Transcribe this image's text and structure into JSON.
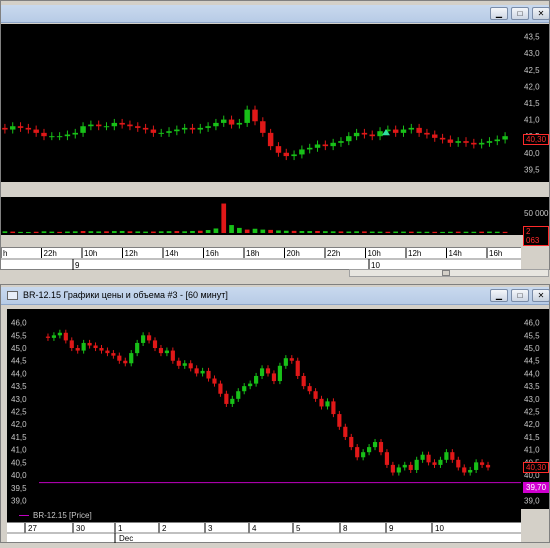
{
  "window1": {
    "buttons": {
      "minimize": "▁",
      "restore": "□",
      "close": "✕"
    },
    "price_axis": [
      "43,5",
      "43,0",
      "42,5",
      "42,0",
      "41,5",
      "41,0",
      "40,5",
      "40,0",
      "39,5"
    ],
    "price_tag": "40,30",
    "volume_axis": [
      "50 000"
    ],
    "volume_tag": "2 063",
    "time_labels": [
      "h",
      "22h",
      "10h",
      "12h",
      "14h",
      "16h",
      "18h",
      "20h",
      "22h",
      "10h",
      "12h",
      "14h",
      "16h"
    ],
    "day_labels": [
      "9",
      "10"
    ]
  },
  "window2": {
    "title": "BR-12.15 Графики цены и объема #3 - [60 минут]",
    "buttons": {
      "minimize": "▁",
      "restore": "□",
      "close": "✕"
    },
    "price_axis": [
      "46,0",
      "45,5",
      "45,0",
      "44,5",
      "44,0",
      "43,5",
      "43,0",
      "42,5",
      "42,0",
      "41,5",
      "41,0",
      "40,5",
      "40,0",
      "39,5",
      "39,0"
    ],
    "price_tag": "40,30",
    "line_tag": "39,70",
    "legend": "BR-12.15 [Price]",
    "day_labels": [
      "27",
      "30",
      "1",
      "2",
      "3",
      "4",
      "5",
      "8",
      "9",
      "10"
    ],
    "month_label": "Dec"
  },
  "colors": {
    "up": "#18c018",
    "down": "#e01818",
    "line": "#c000c0",
    "marker": "#30e0a0"
  },
  "chart_data": [
    {
      "type": "candlestick",
      "title": "",
      "ylim": [
        39.3,
        43.7
      ],
      "close_series": [
        40.7,
        40.8,
        40.75,
        40.7,
        40.6,
        40.5,
        40.5,
        40.5,
        40.55,
        40.6,
        40.8,
        40.85,
        40.8,
        40.8,
        40.9,
        40.85,
        40.8,
        40.75,
        40.7,
        40.6,
        40.6,
        40.65,
        40.7,
        40.75,
        40.7,
        40.75,
        40.8,
        40.9,
        41.0,
        40.85,
        40.9,
        41.3,
        40.95,
        40.6,
        40.2,
        40.0,
        39.9,
        39.95,
        40.1,
        40.15,
        40.25,
        40.2,
        40.3,
        40.35,
        40.5,
        40.6,
        40.55,
        40.5,
        40.65,
        40.7,
        40.6,
        40.7,
        40.75,
        40.6,
        40.55,
        40.45,
        40.4,
        40.3,
        40.35,
        40.3,
        40.25,
        40.3,
        40.35,
        40.4,
        40.5
      ]
    },
    {
      "type": "bar",
      "title": "",
      "ylim": [
        0,
        60000
      ],
      "values": [
        3000,
        2500,
        2000,
        1800,
        2200,
        3000,
        2500,
        2000,
        2600,
        3000,
        3500,
        3200,
        2800,
        3000,
        3400,
        3600,
        3000,
        2800,
        2500,
        2600,
        3000,
        3200,
        3400,
        3000,
        3600,
        4000,
        5200,
        8000,
        52000,
        14000,
        9000,
        6000,
        7500,
        6000,
        5500,
        4500,
        4000,
        3800,
        3500,
        3400,
        3600,
        3200,
        3000,
        2800,
        2600,
        3000,
        2800,
        2600,
        2400,
        2200,
        2600,
        2500,
        2400,
        2300,
        2200,
        2100,
        2000,
        2200,
        2400,
        2300,
        2200,
        2400,
        2500,
        2300,
        2063
      ]
    },
    {
      "type": "candlestick",
      "title": "",
      "ylim": [
        38.9,
        46.3
      ],
      "close_series": [
        45.4,
        45.5,
        45.6,
        45.3,
        45.0,
        44.9,
        45.2,
        45.1,
        45.0,
        44.9,
        44.8,
        44.7,
        44.5,
        44.4,
        44.8,
        45.2,
        45.5,
        45.3,
        45.0,
        44.8,
        44.9,
        44.5,
        44.3,
        44.4,
        44.2,
        44.0,
        44.1,
        43.8,
        43.6,
        43.2,
        42.8,
        43.0,
        43.3,
        43.5,
        43.6,
        43.9,
        44.2,
        44.0,
        43.7,
        44.3,
        44.6,
        44.5,
        43.9,
        43.5,
        43.3,
        43.0,
        42.7,
        42.9,
        42.4,
        41.9,
        41.5,
        41.1,
        40.7,
        40.9,
        41.1,
        41.3,
        40.9,
        40.4,
        40.1,
        40.3,
        40.4,
        40.2,
        40.6,
        40.8,
        40.5,
        40.4,
        40.6,
        40.9,
        40.6,
        40.3,
        40.1,
        40.2,
        40.5,
        40.4,
        40.3
      ],
      "horizontal_line": 39.7
    }
  ]
}
